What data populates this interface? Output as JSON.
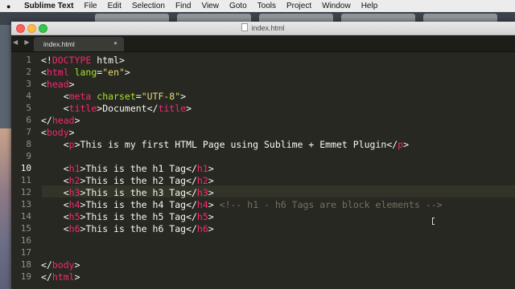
{
  "menubar": {
    "apple_glyph": "",
    "items": [
      "Sublime Text",
      "File",
      "Edit",
      "Selection",
      "Find",
      "View",
      "Goto",
      "Tools",
      "Project",
      "Window",
      "Help"
    ]
  },
  "window": {
    "title": "index.html",
    "tab_label": "index.html",
    "tab_close_glyph": "●",
    "nav_arrows": "◀ ▶"
  },
  "editor": {
    "current_line": 10,
    "line_numbers": [
      "1",
      "2",
      "3",
      "4",
      "5",
      "6",
      "7",
      "8",
      "9",
      "10",
      "11",
      "12",
      "13",
      "14",
      "15",
      "16",
      "17",
      "18",
      "19"
    ],
    "lines": [
      "<!DOCTYPE html>",
      "<html lang=\"en\">",
      "<head>",
      "    <meta charset=\"UTF-8\">",
      "    <title>Document</title>",
      "</head>",
      "<body>",
      "    <p>This is my first HTML Page using Sublime + Emmet Plugin</p>",
      "",
      "    <h1>This is the h1 Tag</h1>",
      "    <h2>This is the h2 Tag</h2>",
      "    <h3>This is the h3 Tag</h3>",
      "    <h4>This is the h4 Tag</h4> <!-- h1 - h6 Tags are block elements -->",
      "    <h5>This is the h5 Tag</h5>",
      "    <h6>This is the h6 Tag</h6>",
      "",
      "",
      "</body>",
      "</html>"
    ]
  },
  "colors": {
    "tag": "#f92672",
    "attribute": "#a6e22e",
    "string": "#e6db74",
    "comment": "#75715e",
    "text": "#f8f8f2",
    "background": "#272822"
  }
}
